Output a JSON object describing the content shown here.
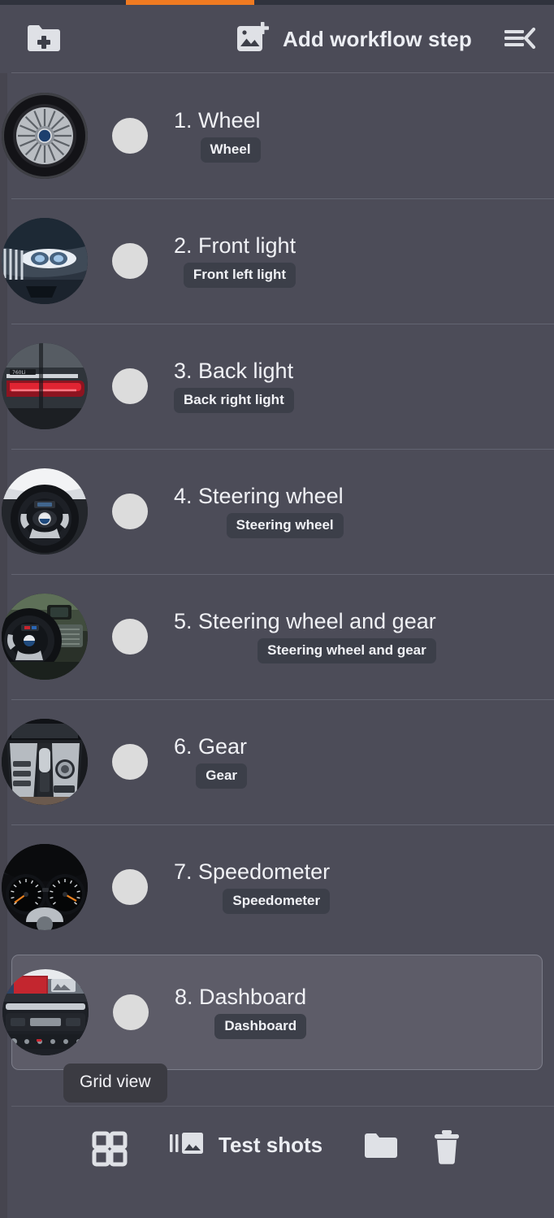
{
  "theme": {
    "background": "#4c4c58",
    "header_bg": "#4b4b57",
    "accent": "#f07a21",
    "tag_bg": "#3c3f49",
    "selected_row_bg": "#5d5c68",
    "dot_color": "#dcdcdc",
    "text_color": "#f0f1f5",
    "tooltip_bg": "#3b3b42"
  },
  "header": {
    "new_folder_icon": "folder-plus-icon",
    "add_step_icon": "add-image-icon",
    "add_step_label": "Add workflow step",
    "collapse_icon": "menu-collapse-icon"
  },
  "steps": [
    {
      "index": "1.",
      "title": "1. Wheel",
      "tag": "Wheel",
      "thumb": "car-wheel-rim",
      "selected": false
    },
    {
      "index": "2.",
      "title": "2. Front light",
      "tag": "Front left light",
      "thumb": "car-front-headlight",
      "selected": false
    },
    {
      "index": "3.",
      "title": "3. Back light",
      "tag": "Back right light",
      "thumb": "car-rear-taillight",
      "selected": false
    },
    {
      "index": "4.",
      "title": "4. Steering wheel",
      "tag": "Steering wheel",
      "thumb": "steering-wheel",
      "selected": false
    },
    {
      "index": "5.",
      "title": "5. Steering wheel and gear",
      "tag": "Steering wheel and gear",
      "thumb": "steering-wheel-and-gear",
      "selected": false
    },
    {
      "index": "6.",
      "title": "6. Gear",
      "tag": "Gear",
      "thumb": "gear-shifter-console",
      "selected": false
    },
    {
      "index": "7.",
      "title": "7. Speedometer",
      "tag": "Speedometer",
      "thumb": "speedometer-gauges",
      "selected": false
    },
    {
      "index": "8.",
      "title": "8. Dashboard",
      "tag": "Dashboard",
      "thumb": "car-dashboard-center-console",
      "selected": true
    }
  ],
  "tooltip": {
    "text": "Grid view"
  },
  "bottom_bar": {
    "grid_view_icon": "grid-view-icon",
    "test_shots_icon": "photo-library-icon",
    "test_shots_label": "Test shots",
    "folder_icon": "folder-icon",
    "delete_icon": "trash-icon"
  }
}
